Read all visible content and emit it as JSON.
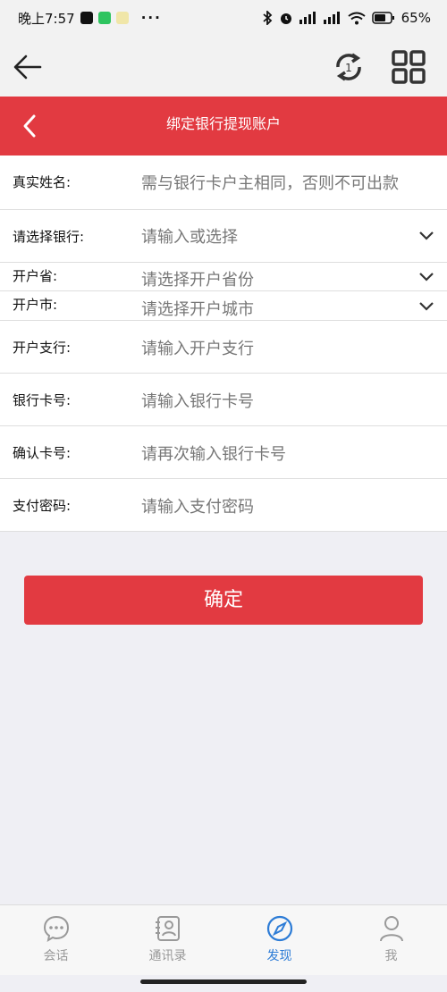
{
  "status": {
    "time": "晚上7:57",
    "dots": "···",
    "battery": "65"
  },
  "header": {
    "title": "绑定银行提现账户"
  },
  "form": {
    "name_label": "真实姓名:",
    "name_placeholder": "需与银行卡户主相同，否则不可出款",
    "bank_label": "请选择银行:",
    "bank_placeholder": "请输入或选择",
    "province_label": "开户省:",
    "province_placeholder": "请选择开户省份",
    "city_label": "开户市:",
    "city_placeholder": "请选择开户城市",
    "branch_label": "开户支行:",
    "branch_placeholder": "请输入开户支行",
    "card_label": "银行卡号:",
    "card_placeholder": "请输入银行卡号",
    "confirm_card_label": "确认卡号:",
    "confirm_card_placeholder": "请再次输入银行卡号",
    "pwd_label": "支付密码:",
    "pwd_placeholder": "请输入支付密码"
  },
  "submit_label": "确定",
  "tabs": [
    {
      "label": "会话",
      "icon": "chat-icon"
    },
    {
      "label": "通讯录",
      "icon": "contacts-icon"
    },
    {
      "label": "发现",
      "icon": "compass-icon"
    },
    {
      "label": "我",
      "icon": "person-icon"
    }
  ],
  "colors": {
    "accent_red": "#e23a41",
    "tab_active": "#2d7cd6"
  }
}
